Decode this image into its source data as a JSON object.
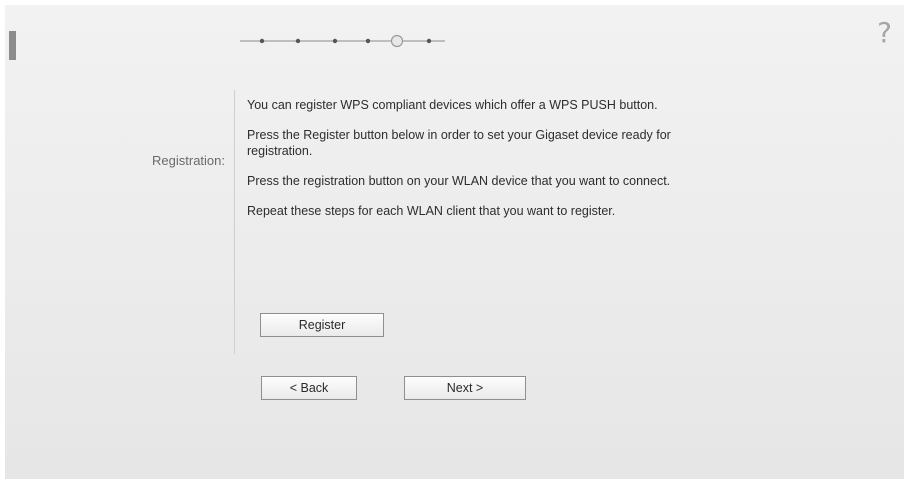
{
  "header": {
    "help_icon": "help-icon",
    "wizard_progress": {
      "total_steps": 6,
      "current_step": 5
    }
  },
  "registration": {
    "label": "Registration:",
    "paragraphs": [
      "You can register WPS compliant devices which offer a WPS PUSH button.",
      "Press the Register button below in order to set your Gigaset device ready for registration.",
      "Press the registration button on your WLAN device that you want to connect.",
      "Repeat these steps for each WLAN client that you want to register."
    ],
    "register_label": "Register"
  },
  "navigation": {
    "back_label": "< Back",
    "next_label": "Next >"
  },
  "colors": {
    "panel_background": "#efefef",
    "text": "#2d2d2d",
    "label_text": "#6a6a6a",
    "button_border": "#8f8f8f"
  }
}
